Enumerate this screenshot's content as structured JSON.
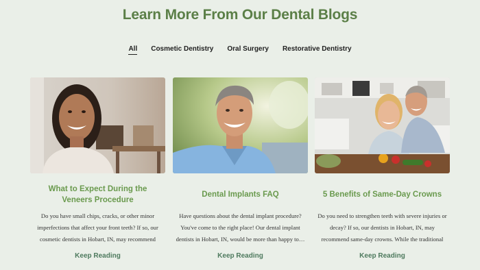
{
  "section_title": "Learn More From Our Dental Blogs",
  "tabs": [
    {
      "label": "All",
      "active": true
    },
    {
      "label": "Cosmetic Dentistry",
      "active": false
    },
    {
      "label": "Oral Surgery",
      "active": false
    },
    {
      "label": "Restorative Dentistry",
      "active": false
    }
  ],
  "cards": [
    {
      "title": "What to Expect During the Veneers Procedure",
      "excerpt": "Do you have small chips, cracks, or other minor imperfections that affect your front teeth? If so, our cosmetic dentists in Hobart, IN, may recommend the…",
      "cta": "Keep Reading"
    },
    {
      "title": "Dental Implants FAQ",
      "excerpt": "Have questions about the dental implant procedure? You've come to the right place! Our dental implant dentists in Hobart, IN, would be more than happy to…",
      "cta": "Keep Reading"
    },
    {
      "title": "5 Benefits of Same-Day Crowns",
      "excerpt": "Do you need to strengthen teeth with severe injuries or decay? If so, our dentists in Hobart, IN, may recommend same-day crowns. While the traditional dental crown…",
      "cta": "Keep Reading"
    }
  ],
  "colors": {
    "background": "#eaefe8",
    "title_green": "#5b7f47",
    "card_heading_green": "#6a9a4e",
    "link_green": "#4e7a5e"
  }
}
